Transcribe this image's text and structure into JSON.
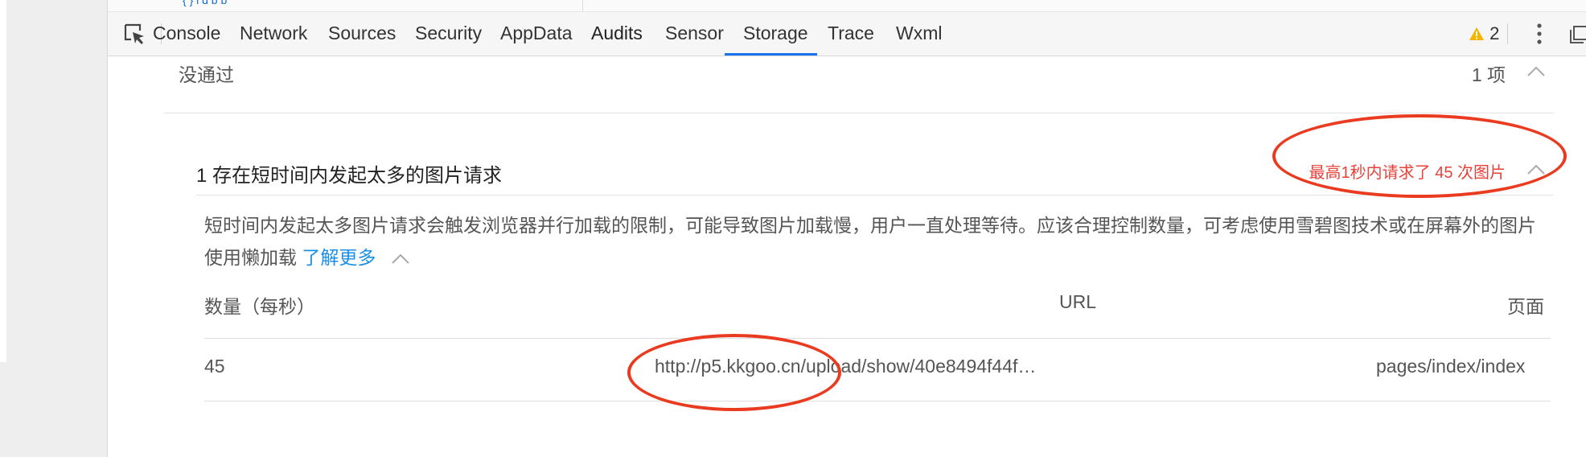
{
  "top_fragment": "{ } i d  b  b",
  "tabs": [
    {
      "label": "Console"
    },
    {
      "label": "Network"
    },
    {
      "label": "Sources"
    },
    {
      "label": "Security"
    },
    {
      "label": "AppData"
    },
    {
      "label": "Audits",
      "active": true
    },
    {
      "label": "Sensor"
    },
    {
      "label": "Storage"
    },
    {
      "label": "Trace"
    },
    {
      "label": "Wxml"
    }
  ],
  "warnings": {
    "count": "2",
    "icon": "warning-triangle-icon"
  },
  "fail_section": {
    "label": "没通过",
    "count": "1 项"
  },
  "issue": {
    "title": "1 存在短时间内发起太多的图片请求",
    "summary": "最高1秒内请求了 45 次图片",
    "description": "短时间内发起太多图片请求会触发浏览器并行加载的限制，可能导致图片加载慢，用户一直处理等待。应该合理控制数量，可考虑使用雪碧图技术或在屏幕外的图片使用懒加载",
    "learn_more": "了解更多"
  },
  "table": {
    "headers": [
      "数量（每秒）",
      "URL",
      "页面"
    ],
    "rows": [
      {
        "count": "45",
        "url": "http://p5.kkgoo.cn/upload/show/40e8494f44f…",
        "page": "pages/index/index"
      }
    ]
  },
  "colors": {
    "accent": "#1a73e8",
    "link": "#1a8fe8",
    "highlight": "#ea3a1f",
    "issue_summary": "#e8423b"
  }
}
